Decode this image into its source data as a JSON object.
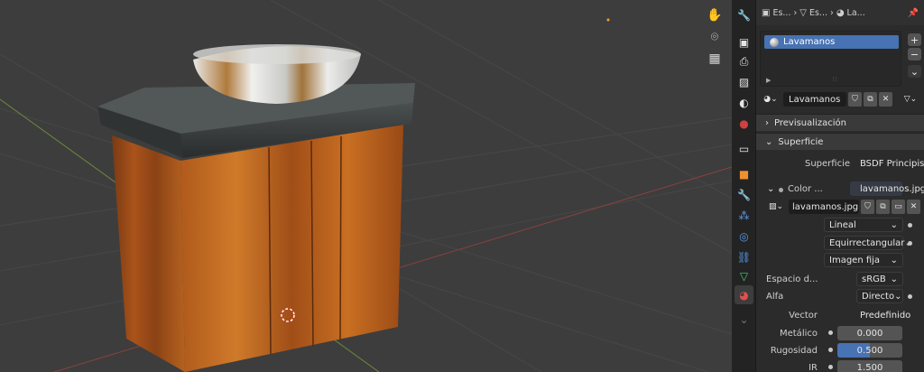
{
  "colors": {
    "viewport_bg": "#3d3d3d",
    "panel_bg": "#2b2b2b",
    "accent": "#4772b3",
    "shader_socket": "#4bc34b",
    "color_socket": "#c7c729",
    "vector_socket": "#6363c7"
  },
  "viewport": {
    "gizmo_icons": [
      "hand-icon",
      "camera-icon",
      "grid-icon"
    ]
  },
  "breadcrumb": {
    "items": [
      "Es...",
      "Es...",
      "La..."
    ],
    "icons": [
      "object-icon",
      "mesh-icon",
      "material-icon"
    ]
  },
  "material_slots": {
    "slots": [
      "Lavamanos"
    ],
    "add_label": "+",
    "remove_label": "−",
    "more_label": "⌄"
  },
  "material_selector": {
    "name": "Lavamanos"
  },
  "sections": {
    "preview": "Previsualización",
    "surface": "Superficie"
  },
  "surface": {
    "surface_label": "Superficie",
    "surface_value": "BSDF Principista",
    "color_label": "Color ...",
    "color_value": "lavamanos.jpg",
    "image_name": "lavamanos.jpg",
    "interpolation": "Lineal",
    "projection": "Equirrectangular",
    "source": "Imagen fija",
    "colorspace_label": "Espacio d...",
    "colorspace_value": "sRGB",
    "alpha_label": "Alfa",
    "alpha_value": "Directo",
    "vector_label": "Vector",
    "vector_value": "Predefinido",
    "metallic_label": "Metálico",
    "metallic_value": "0.000",
    "roughness_label": "Rugosidad",
    "roughness_value": "0.500",
    "roughness_fraction": 0.5,
    "ior_label": "IR",
    "ior_value": "1.500"
  }
}
